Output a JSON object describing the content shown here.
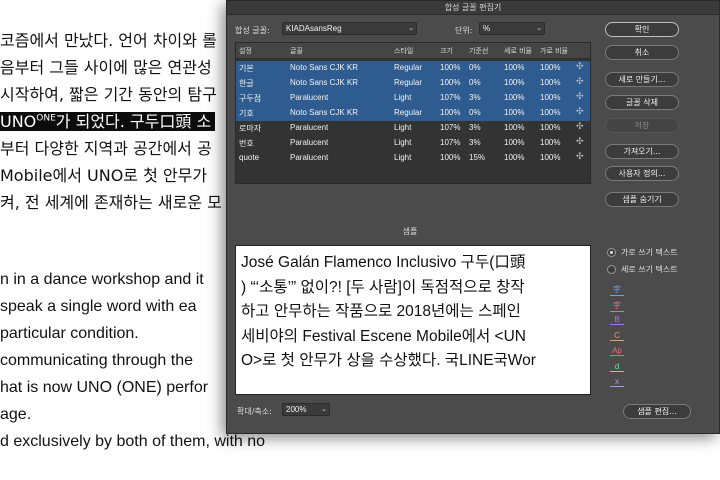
{
  "document": {
    "lines": [
      {
        "text": "코즘에서 만났다. 언어 차이와 롤",
        "lang": "ko"
      },
      {
        "text": "음부터 그들 사이에 많은 연관성",
        "lang": "ko"
      },
      {
        "text": "시작하여, 짧은 기간 동안의 탐구",
        "lang": "ko"
      },
      {
        "text": "UNO",
        "lang": "ko",
        "highlight": true,
        "sup": "ONE",
        "rest": "가 되었다. 구두口頭 소"
      },
      {
        "text": "부터 다양한 지역과 공간에서 공",
        "lang": "ko"
      },
      {
        "text": "Mobile에서 UNO로 첫 안무가",
        "lang": "ko"
      },
      {
        "text": "켜, 전 세계에 존재하는 새로운 모",
        "lang": "ko"
      },
      {
        "text": "n in a dance workshop and it",
        "lang": "en"
      },
      {
        "text": "speak a single word with ea",
        "lang": "en"
      },
      {
        "text": "particular condition.",
        "lang": "en"
      },
      {
        "text": "communicating through the",
        "lang": "en"
      },
      {
        "text": "hat is now UNO (ONE) perfor",
        "lang": "en"
      },
      {
        "text": "age.",
        "lang": "en"
      },
      {
        "text": "d exclusively by both of them, with no",
        "lang": "en"
      }
    ]
  },
  "dialog": {
    "title": "합성 글꼴 편집기",
    "composite_font_label": "합성 글꼴:",
    "composite_font_value": "KIADAsansReg",
    "unit_label": "단위:",
    "unit_value": "%",
    "table": {
      "headers": [
        "설정",
        "글꼴",
        "스타일",
        "크기",
        "기준선",
        "세로 비율",
        "가로 비율"
      ],
      "rows": [
        {
          "setting": "기본",
          "font": "Noto Sans CJK KR",
          "style": "Regular",
          "size": "100%",
          "baseline": "0%",
          "vscale": "100%",
          "hscale": "100%",
          "selected": true
        },
        {
          "setting": "한글",
          "font": "Noto Sans CJK KR",
          "style": "Regular",
          "size": "100%",
          "baseline": "0%",
          "vscale": "100%",
          "hscale": "100%",
          "selected": true
        },
        {
          "setting": "구두점",
          "font": "Paralucent",
          "style": "Light",
          "size": "107%",
          "baseline": "3%",
          "vscale": "100%",
          "hscale": "100%",
          "selected": true
        },
        {
          "setting": "기호",
          "font": "Noto Sans CJK KR",
          "style": "Regular",
          "size": "100%",
          "baseline": "0%",
          "vscale": "100%",
          "hscale": "100%",
          "selected": true
        },
        {
          "setting": "로마자",
          "font": "Paralucent",
          "style": "Light",
          "size": "107%",
          "baseline": "3%",
          "vscale": "100%",
          "hscale": "100%",
          "selected": false
        },
        {
          "setting": "번호",
          "font": "Paralucent",
          "style": "Light",
          "size": "107%",
          "baseline": "3%",
          "vscale": "100%",
          "hscale": "100%",
          "selected": false
        },
        {
          "setting": "quote",
          "font": "Paralucent",
          "style": "Light",
          "size": "100%",
          "baseline": "15%",
          "vscale": "100%",
          "hscale": "100%",
          "selected": false
        }
      ]
    },
    "buttons": {
      "ok": "확인",
      "cancel": "취소",
      "new": "새로 만들기...",
      "delete_font": "글꼴 삭제",
      "save": "저장",
      "import": "가져오기...",
      "custom": "사용자 정의...",
      "hide_sample": "샘플 숨기기",
      "edit_sample": "샘플 편집..."
    },
    "sample_label": "샘플",
    "sample_lines": [
      "José Galán Flamenco Inclusivo 구두(口頭",
      ") “‘소통’” 없이?! [두 사람]이 독점적으로 창작",
      "하고 안무하는 작품으로 2018년에는 스페인",
      "세비야의 Festival Escene Mobile에서 <UN",
      "O>로 첫 안무가 상을 수상했다. 국LINE국Wor"
    ],
    "radio": {
      "horizontal": "가로 쓰기 텍스트",
      "vertical": "세로 쓰기 텍스트"
    },
    "view_icons": [
      "字",
      "字",
      "B",
      "C",
      "Ap",
      "d",
      "x"
    ],
    "zoom_label": "확대/축소:",
    "zoom_value": "200%",
    "colors": {
      "selection": "#2f5c90",
      "dialog_bg": "#4b4b4b"
    }
  }
}
